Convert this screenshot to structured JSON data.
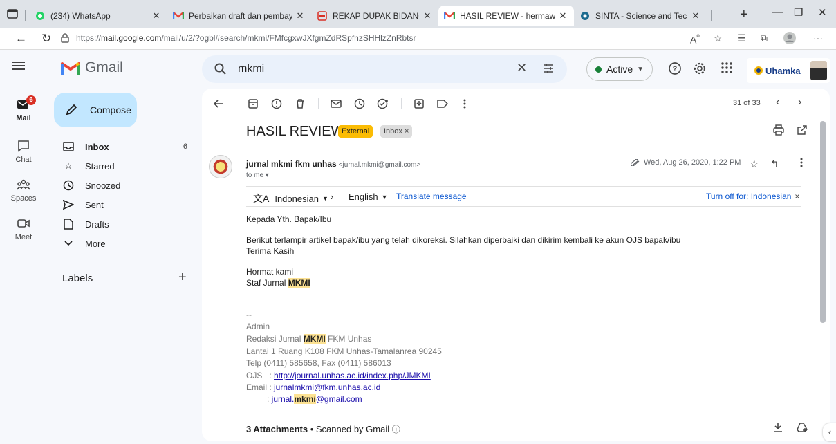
{
  "browser": {
    "tabs": [
      {
        "label": "(234) WhatsApp",
        "favicon": "whatsapp-icon"
      },
      {
        "label": "Perbaikan draft dan pembaya",
        "favicon": "gmail-icon"
      },
      {
        "label": "REKAP DUPAK BIDANG B _ LL",
        "favicon": "pdf-icon"
      },
      {
        "label": "HASIL REVIEW - hermawan.sa",
        "favicon": "gmail-icon",
        "active": true
      },
      {
        "label": "SINTA - Science and Technolo",
        "favicon": "sinta-icon"
      }
    ],
    "url_prefix": "https://",
    "url_host": "mail.google.com",
    "url_path": "/mail/u/2/?ogbl#search/mkmi/FMfcgxwJXfgmZdRSpfnzSHHlzZnRbtsr"
  },
  "header": {
    "app_name": "Gmail",
    "search_value": "mkmi",
    "status": "Active",
    "org_name": "Uhamka"
  },
  "rail": {
    "mail": "Mail",
    "mail_badge": "6",
    "chat": "Chat",
    "spaces": "Spaces",
    "meet": "Meet"
  },
  "sidebar": {
    "compose": "Compose",
    "items": [
      {
        "label": "Inbox",
        "count": "6"
      },
      {
        "label": "Starred"
      },
      {
        "label": "Snoozed"
      },
      {
        "label": "Sent"
      },
      {
        "label": "Drafts"
      },
      {
        "label": "More"
      }
    ],
    "labels_title": "Labels"
  },
  "toolbar": {
    "pager": "31 of 33"
  },
  "message": {
    "subject": "HASIL REVIEW",
    "external_badge": "External",
    "inbox_chip": "Inbox",
    "sender_name": "jurnal mkmi fkm unhas",
    "sender_email": "<jurnal.mkmi@gmail.com>",
    "to": "to me",
    "date": "Wed, Aug 26, 2020, 1:22 PM",
    "translate": {
      "from": "Indonesian",
      "to": "English",
      "link": "Translate message",
      "turn_off": "Turn off for: Indonesian"
    },
    "body": {
      "greeting": "Kepada Yth. Bapak/Ibu",
      "line1": "Berikut terlampir artikel bapak/ibu yang telah dikoreksi. Silahkan diperbaiki dan dikirim kembali ke akun OJS bapak/ibu",
      "line2": "Terima Kasih",
      "closing1": "Hormat kami",
      "closing2_prefix": "Staf Jurnal ",
      "closing2_hl": "MKMI"
    },
    "signature": {
      "dashes": "--",
      "admin": "Admin",
      "redaksi_prefix": "Redaksi Jurnal ",
      "redaksi_hl": "MKMI",
      "redaksi_suffix": " FKM Unhas",
      "address": "Lantai 1 Ruang K108 FKM Unhas-Tamalanrea 90245",
      "telp": "Telp (0411) 585658, Fax (0411) 586013",
      "ojs_label": "OJS   : ",
      "ojs_link": "http://journal.unhas.ac.id/index.php/JMKMI",
      "email_label": "Email : ",
      "email_link1": "jurnalmkmi@fkm.unhas.ac.id",
      "email_label2": ": ",
      "email_link2_prefix": "jurnal.",
      "email_link2_hl": "mkmi",
      "email_link2_suffix": "@gmail.com"
    },
    "attachments_count": "3 Attachments",
    "attachments_note": " •  Scanned by Gmail"
  }
}
